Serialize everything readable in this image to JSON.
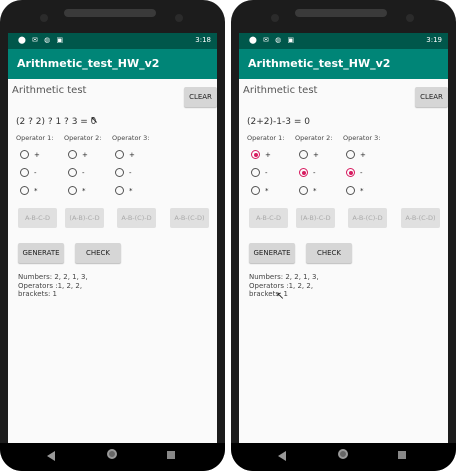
{
  "screens": [
    {
      "status_time": "3:18",
      "app_title": "Arithmetic_test_HW_v2",
      "title": "Arithmetic test",
      "clear_label": "CLEAR",
      "expression": "(2 ? 2) ? 1 ? 3 = 0",
      "operator_labels": [
        "Operator 1:",
        "Operator 2:",
        "Operator 3:"
      ],
      "operator_options": [
        "+",
        "-",
        "*"
      ],
      "selected": [
        null,
        null,
        null
      ],
      "bracket_buttons": [
        "A-B-C-D",
        "(A-B)-C-D",
        "A-B-(C)-D",
        "A-B-(C-D)"
      ],
      "generate_label": "GENERATE",
      "check_label": "CHECK",
      "info_lines": [
        "Numbers: 2, 2, 1, 3,",
        "Operators :1, 2, 2,",
        "brackets: 1"
      ]
    },
    {
      "status_time": "3:19",
      "app_title": "Arithmetic_test_HW_v2",
      "title": "Arithmetic test",
      "clear_label": "CLEAR",
      "expression": "(2+2)-1-3 = 0",
      "operator_labels": [
        "Operator 1:",
        "Operator 2:",
        "Operator 3:"
      ],
      "operator_options": [
        "+",
        "-",
        "*"
      ],
      "selected": [
        0,
        1,
        1
      ],
      "bracket_buttons": [
        "A-B-C-D",
        "(A-B)-C-D",
        "A-B-(C)-D",
        "A-B-(C-D)"
      ],
      "generate_label": "GENERATE",
      "check_label": "CHECK",
      "info_lines": [
        "Numbers: 2, 2, 1, 3,",
        "Operators :1, 2, 2,",
        "brackets: 1"
      ]
    }
  ],
  "icons": {
    "status_left": "⬤ ✉ ◍ ▣",
    "status_right_1": "▾◢ ▮ 3:18",
    "status_right_2": "▾◢ ▮ 3:19",
    "cursor": "↖"
  }
}
